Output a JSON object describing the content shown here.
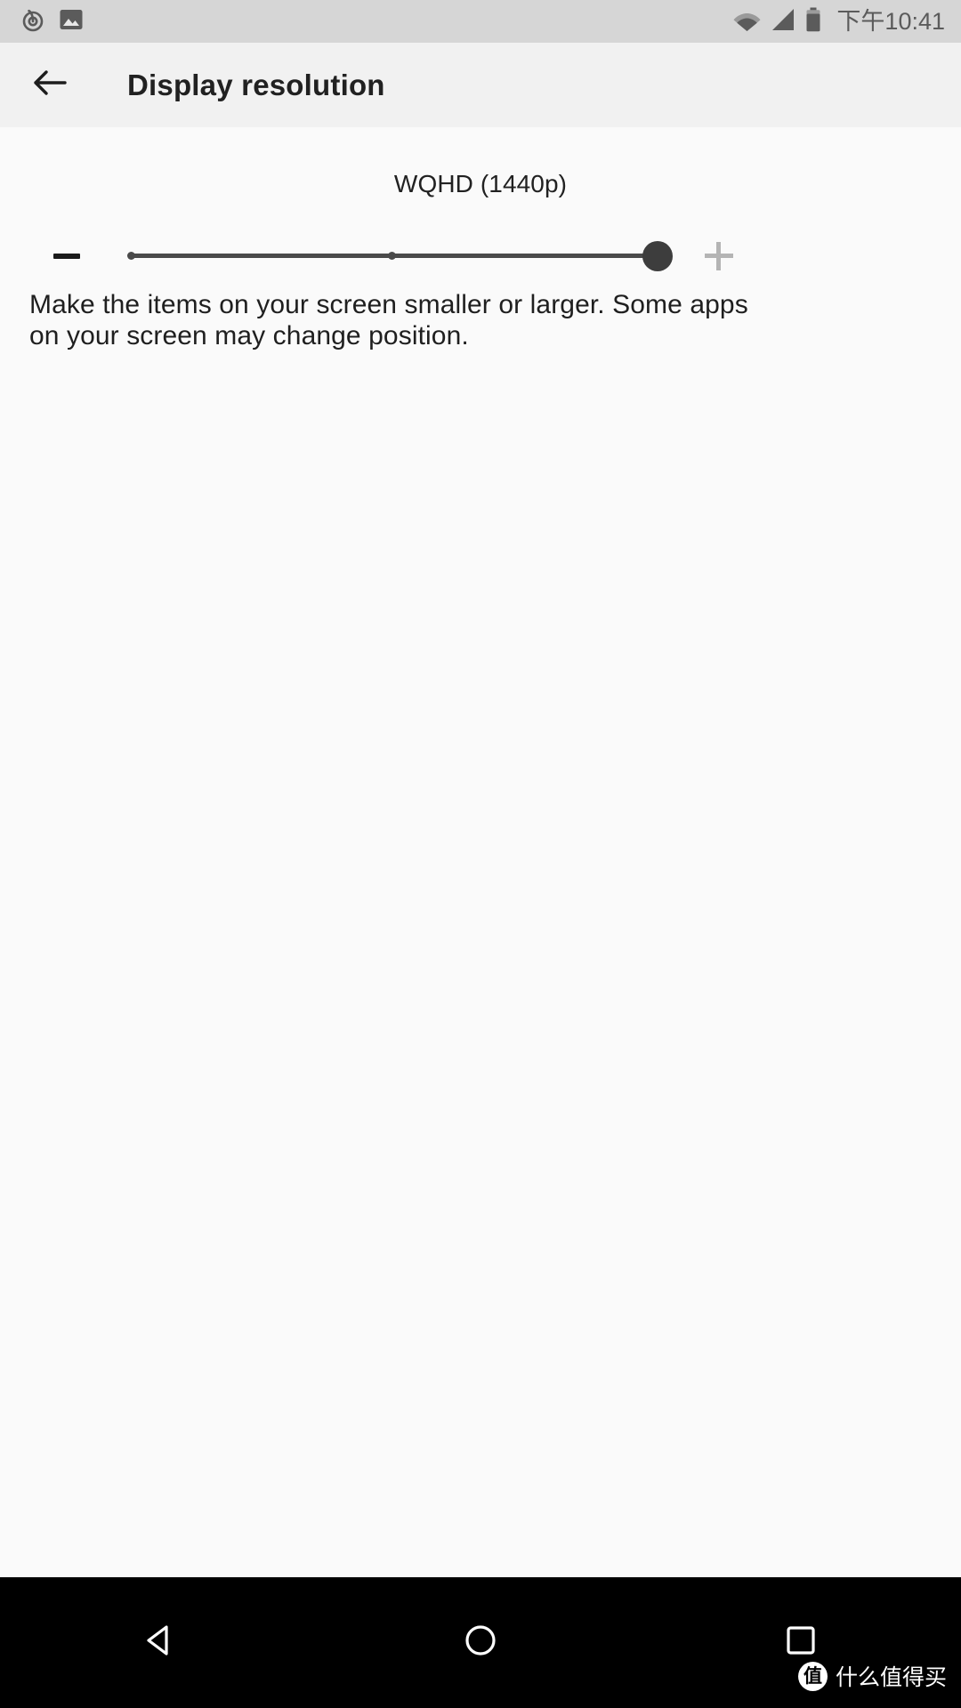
{
  "status_bar": {
    "background": "#d6d6d6",
    "left_icons": [
      {
        "name": "netease-music-icon",
        "label": "NetEase Cloud Music"
      },
      {
        "name": "screenshot-image-icon",
        "label": "Screenshot captured"
      }
    ],
    "right_icons": [
      {
        "name": "wifi-icon",
        "label": "Wi-Fi"
      },
      {
        "name": "cellular-signal-icon",
        "label": "Mobile signal"
      },
      {
        "name": "battery-icon",
        "label": "Battery"
      }
    ],
    "clock": "下午10:41"
  },
  "app_bar": {
    "background": "#f1f1f1",
    "back_icon": "arrow-back-icon",
    "title": "Display resolution"
  },
  "display_resolution": {
    "current_value_label": "WQHD (1440p)",
    "decrease_label": "−",
    "increase_label": "+",
    "slider": {
      "min": 0,
      "max": 2,
      "value": 2,
      "tick_count": 3,
      "active_color": "#4a4a4a",
      "thumb_color": "#3d3d3d"
    },
    "decrease_enabled": true,
    "increase_enabled": false,
    "description": "Make the items on your screen smaller or larger. Some apps on your screen may change position."
  },
  "nav_bar": {
    "background": "#000000",
    "buttons": [
      {
        "name": "nav-back-button",
        "icon": "triangle-back-icon"
      },
      {
        "name": "nav-home-button",
        "icon": "circle-home-icon"
      },
      {
        "name": "nav-recents-button",
        "icon": "square-recents-icon"
      }
    ]
  },
  "watermark": {
    "logo_char": "值",
    "text": "什么值得买"
  }
}
